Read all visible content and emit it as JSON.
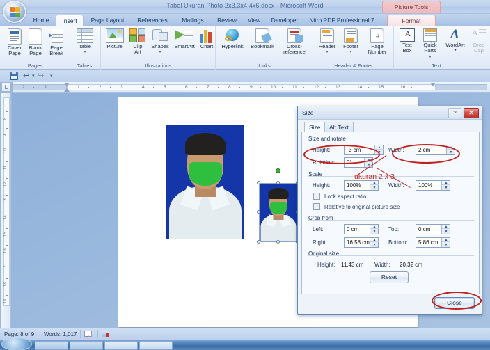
{
  "window": {
    "title": "Tabel Ukuran Photo 2x3,3x4,4x6.docx - Microsoft Word",
    "contextual_tools": "Picture Tools",
    "orb_name": "office-button"
  },
  "ribbon": {
    "tabs": [
      {
        "label": "Home",
        "active": false
      },
      {
        "label": "Insert",
        "active": true
      },
      {
        "label": "Page Layout",
        "active": false
      },
      {
        "label": "References",
        "active": false
      },
      {
        "label": "Mailings",
        "active": false
      },
      {
        "label": "Review",
        "active": false
      },
      {
        "label": "View",
        "active": false
      },
      {
        "label": "Developer",
        "active": false
      },
      {
        "label": "Nitro PDF Professional 7",
        "active": false
      },
      {
        "label": "Format",
        "active": false,
        "contextual": true
      }
    ],
    "groups": [
      {
        "name": "Pages",
        "label": "Pages",
        "items": [
          {
            "label": "Cover\nPage",
            "icon": "cover-page-icon",
            "dropdown": true
          },
          {
            "label": "Blank\nPage",
            "icon": "blank-page-icon",
            "dropdown": false
          },
          {
            "label": "Page\nBreak",
            "icon": "page-break-icon",
            "dropdown": false
          }
        ]
      },
      {
        "name": "Tables",
        "label": "Tables",
        "items": [
          {
            "label": "Table",
            "icon": "table-icon",
            "dropdown": true
          }
        ]
      },
      {
        "name": "Illustrations",
        "label": "Illustrations",
        "items": [
          {
            "label": "Picture",
            "icon": "picture-icon",
            "dropdown": false
          },
          {
            "label": "Clip\nArt",
            "icon": "clip-art-icon",
            "dropdown": false
          },
          {
            "label": "Shapes",
            "icon": "shapes-icon",
            "dropdown": true
          },
          {
            "label": "SmartArt",
            "icon": "smartart-icon",
            "dropdown": false
          },
          {
            "label": "Chart",
            "icon": "chart-icon",
            "dropdown": false
          }
        ]
      },
      {
        "name": "Links",
        "label": "Links",
        "items": [
          {
            "label": "Hyperlink",
            "icon": "hyperlink-icon",
            "dropdown": false
          },
          {
            "label": "Bookmark",
            "icon": "bookmark-icon",
            "dropdown": false
          },
          {
            "label": "Cross-reference",
            "icon": "cross-reference-icon",
            "dropdown": false
          }
        ]
      },
      {
        "name": "HeaderFooter",
        "label": "Header & Footer",
        "items": [
          {
            "label": "Header",
            "icon": "header-icon",
            "dropdown": true
          },
          {
            "label": "Footer",
            "icon": "footer-icon",
            "dropdown": true
          },
          {
            "label": "Page\nNumber",
            "icon": "page-number-icon",
            "dropdown": true
          }
        ]
      },
      {
        "name": "Text",
        "label": "Text",
        "items": [
          {
            "label": "Text\nBox",
            "icon": "text-box-icon",
            "dropdown": true
          },
          {
            "label": "Quick\nParts",
            "icon": "quick-parts-icon",
            "dropdown": true
          },
          {
            "label": "WordArt",
            "icon": "wordart-icon",
            "dropdown": true
          },
          {
            "label": "Drop\nCap",
            "icon": "drop-cap-icon",
            "dropdown": true,
            "disabled": true
          }
        ]
      }
    ]
  },
  "quick_access": {
    "save": "save-icon",
    "undo": "undo-icon",
    "redo": "redo-icon",
    "customize": "customize-qat-icon"
  },
  "rulers": {
    "horizontal_ticks": [
      "2",
      "1",
      "1",
      "2",
      "3",
      "4",
      "5",
      "6",
      "7",
      "8",
      "9",
      "10",
      "11",
      "12",
      "13",
      "14",
      "15",
      "16"
    ],
    "vertical_ticks": [
      "8",
      "9",
      "10",
      "11",
      "12",
      "13",
      "14",
      "15",
      "16",
      "17",
      "18",
      "19"
    ]
  },
  "document": {
    "photos": [
      {
        "name": "photo-large",
        "selected": false
      },
      {
        "name": "photo-small-selected",
        "selected": true
      }
    ]
  },
  "dialog": {
    "title": "Size",
    "help_glyph": "?",
    "close_glyph": "✕",
    "tabs": [
      {
        "label": "Size",
        "active": true
      },
      {
        "label": "Alt Text",
        "active": false
      }
    ],
    "sections": {
      "size_and_rotate": {
        "legend": "Size and rotate",
        "height_label": "Height:",
        "height_value": "3 cm",
        "width_label": "Width:",
        "width_value": "2 cm",
        "rotation_label": "Rotation:",
        "rotation_value": "0°"
      },
      "scale": {
        "legend": "Scale",
        "height_label": "Height:",
        "height_value": "100%",
        "width_label": "Width:",
        "width_value": "100%",
        "lock_aspect_label": "Lock aspect ratio",
        "lock_aspect_checked": false,
        "relative_label": "Relative to original picture size",
        "relative_checked": false
      },
      "crop_from": {
        "legend": "Crop from",
        "left_label": "Left:",
        "left_value": "0 cm",
        "top_label": "Top:",
        "top_value": "0 cm",
        "right_label": "Right:",
        "right_value": "16.58 cm",
        "bottom_label": "Bottom:",
        "bottom_value": "5.86 cm"
      },
      "original_size": {
        "legend": "Original size",
        "height_label": "Height:",
        "height_value": "11.43 cm",
        "width_label": "Width:",
        "width_value": "20.32 cm",
        "reset_button": "Reset"
      }
    },
    "close_button": "Close"
  },
  "annotation": {
    "note": "ukuran 2 x 3",
    "color": "#d42121"
  },
  "status_bar": {
    "page": "Page: 8 of 9",
    "words": "Words: 1,017",
    "proofing_icon": "proofing-errors-icon",
    "language_icon": "language-icon"
  }
}
